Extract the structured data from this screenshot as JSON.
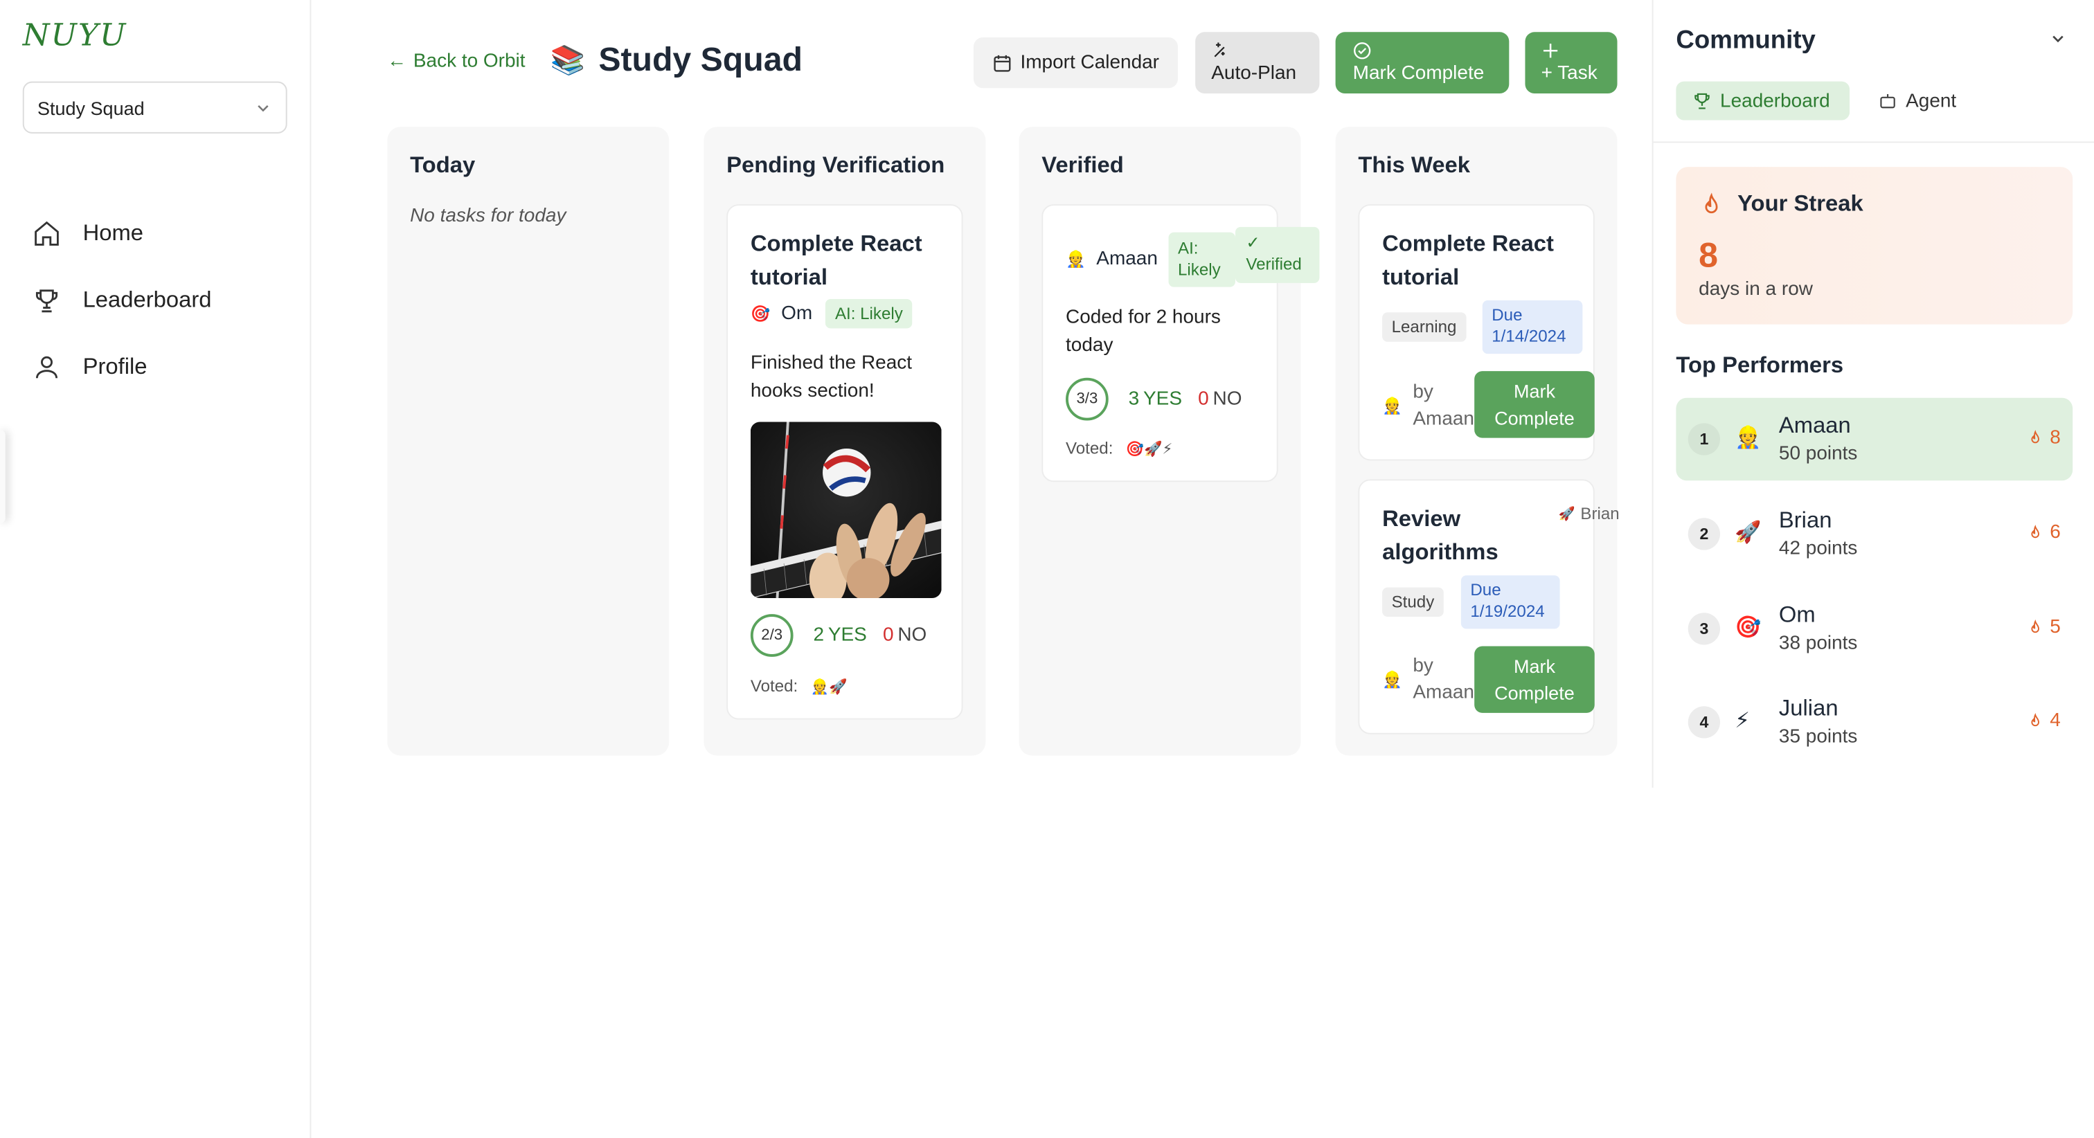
{
  "app": {
    "logo": "NUYU",
    "squad_selector": "Study Squad"
  },
  "nav": [
    {
      "label": "Home",
      "icon": "home-icon"
    },
    {
      "label": "Leaderboard",
      "icon": "trophy-icon"
    },
    {
      "label": "Profile",
      "icon": "user-icon"
    }
  ],
  "header": {
    "back_label": "Back to Orbit",
    "title_emoji": "📚",
    "title": "Study Squad",
    "import_label": "Import Calendar",
    "autoplan_label": "Auto-Plan",
    "mark_complete_label": "Mark Complete",
    "add_task_label": "+ Task"
  },
  "columns": {
    "today": {
      "title": "Today",
      "empty_text": "No tasks for today"
    },
    "pending": {
      "title": "Pending Verification",
      "card": {
        "title": "Complete React tutorial",
        "user_emoji": "🎯",
        "user": "Om",
        "ai_badge": "AI: Likely",
        "note": "Finished the React hooks section!",
        "ring": "2/3",
        "yes_count": "2",
        "yes_label": "YES",
        "no_count": "0",
        "no_label": "NO",
        "voted_label": "Voted:",
        "voted_emojis": "👷🚀"
      }
    },
    "verified": {
      "title": "Verified",
      "card": {
        "user_emoji": "👷",
        "user": "Amaan",
        "ai_badge_line1": "AI:",
        "ai_badge_line2": "Likely",
        "verified_check": "✓",
        "verified_label": "Verified",
        "note": "Coded for 2 hours today",
        "ring": "3/3",
        "yes_count": "3",
        "yes_label": "YES",
        "no_count": "0",
        "no_label": "NO",
        "voted_label": "Voted:",
        "voted_emojis": "🎯🚀⚡"
      }
    },
    "week": {
      "title": "This Week",
      "cards": [
        {
          "title": "Complete React tutorial",
          "category": "Learning",
          "due_label": "Due",
          "due_date": "1/14/2024",
          "by_emoji": "👷",
          "by_label": "by",
          "by_user": "Amaan",
          "button": "Mark Complete"
        },
        {
          "title": "Review algorithms",
          "assignee_emoji": "🚀",
          "assignee": "Brian",
          "category": "Study",
          "due_label": "Due",
          "due_date": "1/19/2024",
          "by_emoji": "👷",
          "by_label": "by",
          "by_user": "Amaan",
          "button": "Mark Complete"
        }
      ]
    }
  },
  "community": {
    "title": "Community",
    "tabs": [
      {
        "label": "Leaderboard",
        "active": true
      },
      {
        "label": "Agent",
        "active": false
      }
    ],
    "streak": {
      "title": "Your Streak",
      "value": "8",
      "subtitle": "days in a row"
    },
    "top_performers_title": "Top Performers",
    "performers": [
      {
        "rank": "1",
        "emoji": "👷",
        "name": "Amaan",
        "points": "50 points",
        "streak": "8"
      },
      {
        "rank": "2",
        "emoji": "🚀",
        "name": "Brian",
        "points": "42 points",
        "streak": "6"
      },
      {
        "rank": "3",
        "emoji": "🎯",
        "name": "Om",
        "points": "38 points",
        "streak": "5"
      },
      {
        "rank": "4",
        "emoji": "⚡",
        "name": "Julian",
        "points": "35 points",
        "streak": "4"
      }
    ]
  },
  "colors": {
    "accent_green": "#5aa35c",
    "text_green": "#2e7d32",
    "streak_orange": "#e0632c",
    "no_red": "#d32f2f"
  }
}
